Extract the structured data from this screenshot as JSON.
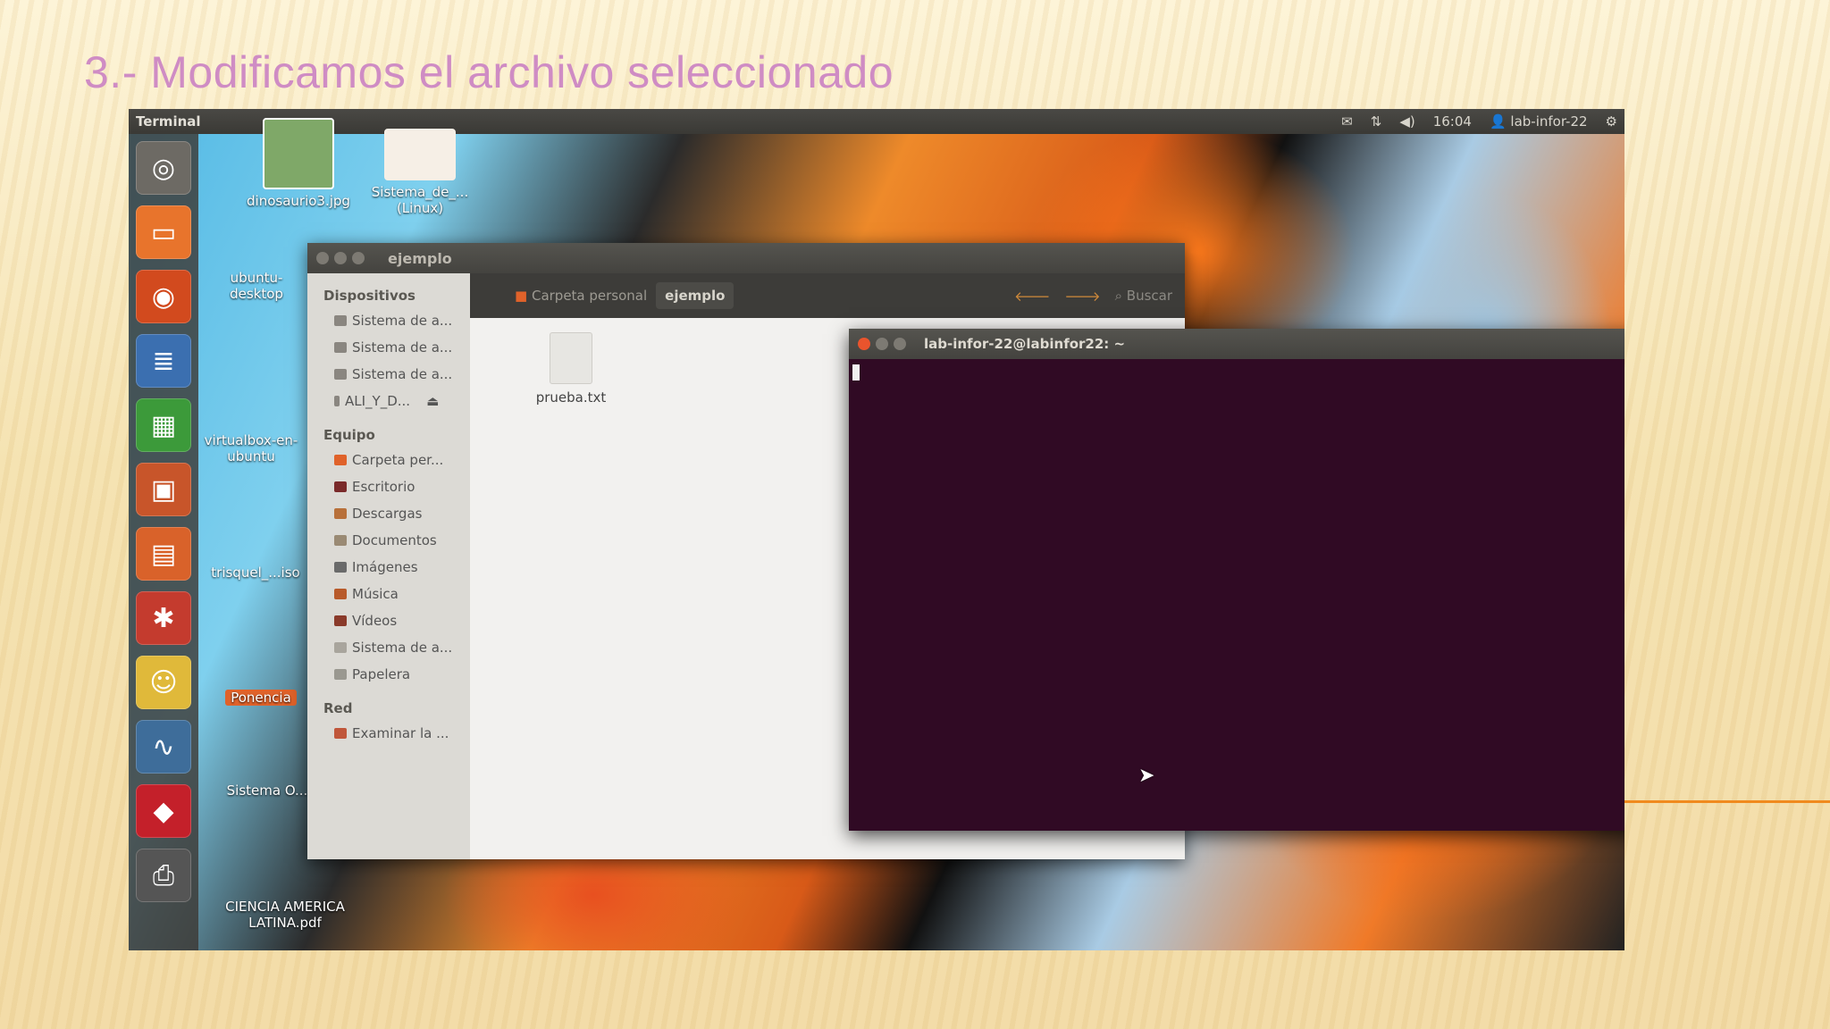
{
  "slide": {
    "title": "3.- Modificamos el archivo seleccionado"
  },
  "menubar": {
    "app_name": "Terminal",
    "time": "16:04",
    "user": "lab-infor-22"
  },
  "desktop": {
    "icons": [
      {
        "label": "dinosaurio3.jpg"
      },
      {
        "label": "Sistema_de_... (Linux)"
      },
      {
        "label": "ubuntu-desktop"
      },
      {
        "label": "virtualbox-en-ubuntu"
      },
      {
        "label": "trisquel_...iso"
      },
      {
        "label": "Ponencia"
      },
      {
        "label": "Sistema O..."
      },
      {
        "label": "CIENCIA AMERICA LATINA.pdf"
      }
    ]
  },
  "file_manager": {
    "title": "ejemplo",
    "breadcrumbs": [
      "Carpeta personal",
      "ejemplo"
    ],
    "search_label": "Buscar",
    "sections": [
      {
        "header": "Dispositivos",
        "items": [
          "Sistema de a...",
          "Sistema de a...",
          "Sistema de a...",
          "ALI_Y_D..."
        ]
      },
      {
        "header": "Equipo",
        "items": [
          "Carpeta per...",
          "Escritorio",
          "Descargas",
          "Documentos",
          "Imágenes",
          "Música",
          "Vídeos",
          "Sistema de a...",
          "Papelera"
        ]
      },
      {
        "header": "Red",
        "items": [
          "Examinar la ..."
        ]
      }
    ],
    "file": "prueba.txt"
  },
  "terminal": {
    "title": "lab-infor-22@labinfor22: ~"
  },
  "colors": {
    "title_pink": "#cf8cc4",
    "terminal_bg": "#300a24",
    "accent_orange": "#f08a1e"
  }
}
